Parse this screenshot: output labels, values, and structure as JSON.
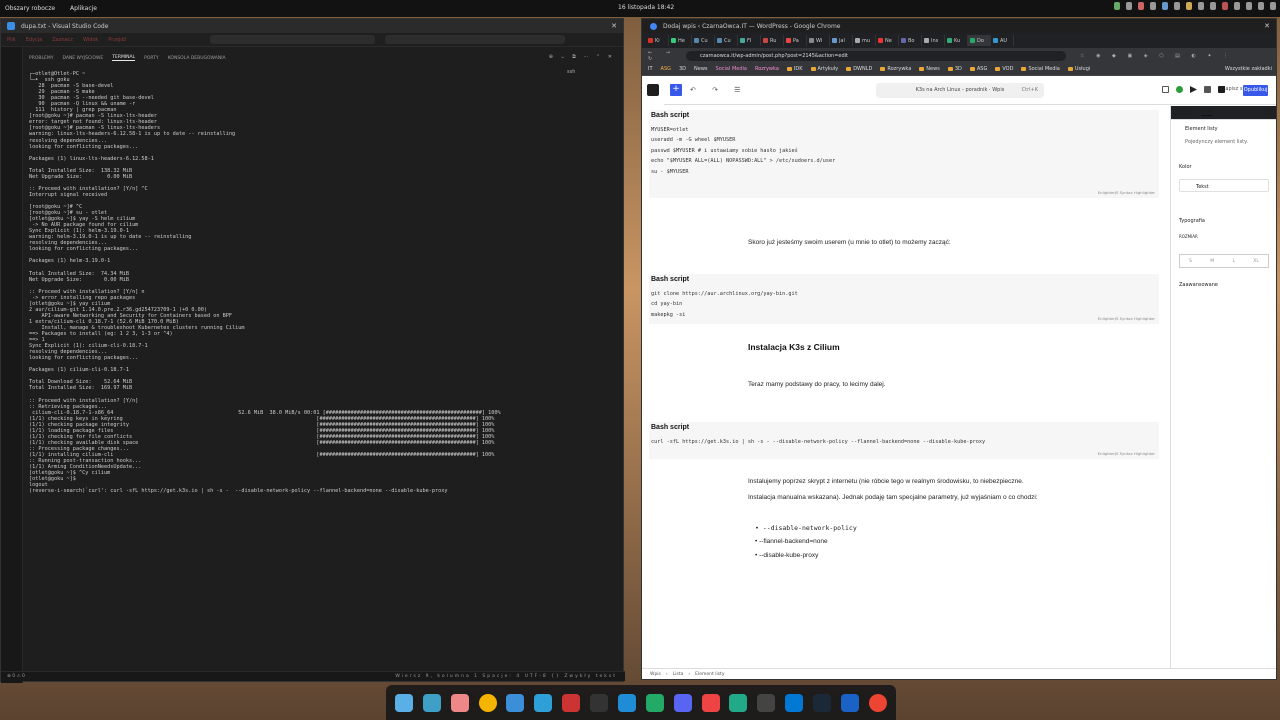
{
  "top_panel": {
    "workspaces": "Obszary robocze",
    "apps": "Aplikacje",
    "clock": "16 listopada 18:42"
  },
  "vscode": {
    "title": "dupa.txt - Visual Studio Code",
    "panel_tabs": [
      "PROBLEMY",
      "DANE WYJŚCIOWE",
      "TERMINAL",
      "PORTY",
      "KONSOLA DEBUGOWANIA"
    ],
    "active_panel_tab": "TERMINAL",
    "terminal_side_label": "ssh",
    "terminal_lines": [
      "┌─otlet@Otlet-PC ~",
      "└─➤  ssh goku",
      "   28  pacman -S base-devel",
      "   29  pacman -S make",
      "   30  pacman -S --needed git base-devel",
      "   90  pacman -Q linux && uname -r",
      "  111  history | grep pacman",
      "[root@goku ~]# pacman -S linux-lts-header",
      "error: target not found: linux-lts-header",
      "[root@goku ~]# pacman -S linux-lts-headers",
      "warning: linux-lts-headers-6.12.58-1 is up to date -- reinstalling",
      "resolving dependencies...",
      "looking for conflicting packages...",
      "",
      "Packages (1) linux-lts-headers-6.12.58-1",
      "",
      "Total Installed Size:  138.32 MiB",
      "Net Upgrade Size:        0.00 MiB",
      "",
      ":: Proceed with installation? [Y/n] ^C",
      "Interrupt signal received",
      "",
      "[root@goku ~]# ^C",
      "[root@goku ~]# su - otlet",
      "[otlet@goku ~]$ yay -S helm cilium",
      " -> No AUR package found for cilium",
      "Sync Explicit (1): helm-3.19.0-1",
      "warning: helm-3.19.0-1 is up to date -- reinstalling",
      "resolving dependencies...",
      "looking for conflicting packages...",
      "",
      "Packages (1) helm-3.19.0-1",
      "",
      "Total Installed Size:  74.34 MiB",
      "Net Upgrade Size:       0.00 MiB",
      "",
      ":: Proceed with installation? [Y/n] n",
      " -> error installing repo packages",
      "[otlet@goku ~]$ yay cilium",
      "2 aur/cilium-git 1.14.0.pre.2.r36.gd254723709-1 (+0 0.00)",
      "    API-aware Networking and Security for Containers based on BPF",
      "1 extra/cilium-cli 0.18.7-1 (52.6 MiB 170.0 MiB)",
      "    Install, manage & troubleshoot Kubernetes clusters running Cilium",
      "==> Packages to install (eg: 1 2 3, 1-3 or ^4)",
      "==> 1",
      "Sync Explicit (1): cilium-cli-0.18.7-1",
      "resolving dependencies...",
      "looking for conflicting packages...",
      "",
      "Packages (1) cilium-cli-0.18.7-1",
      "",
      "Total Download Size:    52.64 MiB",
      "Total Installed Size:  169.97 MiB",
      "",
      ":: Proceed with installation? [Y/n]",
      ":: Retrieving packages...",
      " cilium-cli-0.18.7-1-x86_64                                        52.6 MiB  38.0 MiB/s 00:01 [##################################################] 100%",
      "(1/1) checking keys in keyring                                                              [##################################################] 100%",
      "(1/1) checking package integrity                                                            [##################################################] 100%",
      "(1/1) loading package files                                                                 [##################################################] 100%",
      "(1/1) checking for file conflicts                                                           [##################################################] 100%",
      "(1/1) checking available disk space                                                         [##################################################] 100%",
      ":: Processing package changes...",
      "(1/1) installing cilium-cli                                                                 [##################################################] 100%",
      ":: Running post-transaction hooks...",
      "(1/1) Arming ConditionNeedsUpdate...",
      "[otlet@goku ~]$ ^Cy cilium",
      "[otlet@goku ~]$",
      "logout",
      "(reverse-i-search)`curl': curl -sfL https://get.k3s.io | sh -s -  --disable-network-policy --flannel-backend=none --disable-kube-proxy"
    ],
    "status_right": "Wiersz 9, kolumna 1   Spacje: 4   UTF-8   {}   Zwykły tekst"
  },
  "chrome": {
    "title": "Dodaj wpis ‹ CzarnaOwca.IT — WordPress - Google Chrome",
    "tabs": [
      "Ki",
      "He",
      "Cu",
      "Cu",
      "Fl",
      "Ru",
      "Pa",
      "Wi",
      "jal",
      "mu",
      "Ne",
      "Bo",
      "Ins",
      "Ku",
      "Do",
      "AU"
    ],
    "url": "czarnaowca.it/wp-admin/post.php?post=2145&action=edit",
    "bookmarks": [
      "IT",
      "ASG",
      "3D",
      "News",
      "Social Media",
      "Rozrywka",
      "IDK",
      "Artykuły",
      "DWNLD",
      "Rozrywka",
      "News",
      "3D",
      "ASG",
      "VOD",
      "Social Media",
      "Usługi"
    ],
    "bookmarks_right": "Wszystkie zakładki"
  },
  "wp": {
    "doc_title": "K3s na Arch Linux - poradnik · Wpis",
    "doc_shortcut": "Ctrl+K",
    "save_draft": "Zapisz szkic",
    "publish": "Opublikuj",
    "block1": {
      "title": "Bash script",
      "code": "MYUSER=otlet\nuseradd -m -G wheel $MYUSER\npasswd $MYUSER # i ustawiamy sobie hasło jakieś\necho \"$MYUSER ALL=(ALL) NOPASSWD:ALL\" > /etc/sudoers.d/user\nsu - $MYUSER",
      "credit": "EnlighterJS Syntax Highlighter"
    },
    "para1": "Skoro już jesteśmy swoim userem (u mnie to otlet) to możemy zacząć:",
    "block2": {
      "title": "Bash script",
      "code": "git clone https://aur.archlinux.org/yay-bin.git\ncd yay-bin\nmakepkg -si",
      "credit": "EnlighterJS Syntax Highlighter"
    },
    "heading": "Instalacja K3s z Cilium",
    "para2": "Teraz mamy podstawy do pracy, to lecimy dalej.",
    "block3": {
      "title": "Bash script",
      "code": "curl -sfL https://get.k3s.io | sh -s - --disable-network-policy --flannel-backend=none --disable-kube-proxy",
      "credit": "EnlighterJS Syntax Highlighter"
    },
    "para3a": "Instalujemy poprzez skrypt z internetu (nie róbcie tego w realnym środowisku, to niebezpieczne.",
    "para3b": "Instalacja manualna wskazana). Jednak podaję tam specjalne parametry, już wyjaśniam o co chodzi:",
    "bullets": [
      "--disable-network-policy",
      "--flannel-backend=none",
      "--disable-kube-proxy"
    ],
    "sidebar": {
      "tabs": [
        "Wpis",
        "Blok"
      ],
      "block_name": "Element listy",
      "block_desc": "Pojedynczy element listy.",
      "color": "Kolor",
      "text": "Tekst",
      "typography": "Typografia",
      "size_label": "ROZMIAR",
      "sizes": [
        "S",
        "M",
        "L",
        "XL"
      ],
      "advanced": "Zaawansowane"
    },
    "breadcrumb": [
      "Wpis",
      "Lista",
      "Element listy"
    ]
  },
  "dock_apps": [
    "settings-app",
    "files-app",
    "grid-app",
    "chrome-app",
    "folder-app",
    "editor-app",
    "red-app",
    "terminal-app",
    "blue-app",
    "inkscape-app",
    "discord-app",
    "git-app",
    "gitkraken-app",
    "github-app",
    "vscode-app",
    "steam-app",
    "shield-app",
    "vivaldi-app"
  ]
}
